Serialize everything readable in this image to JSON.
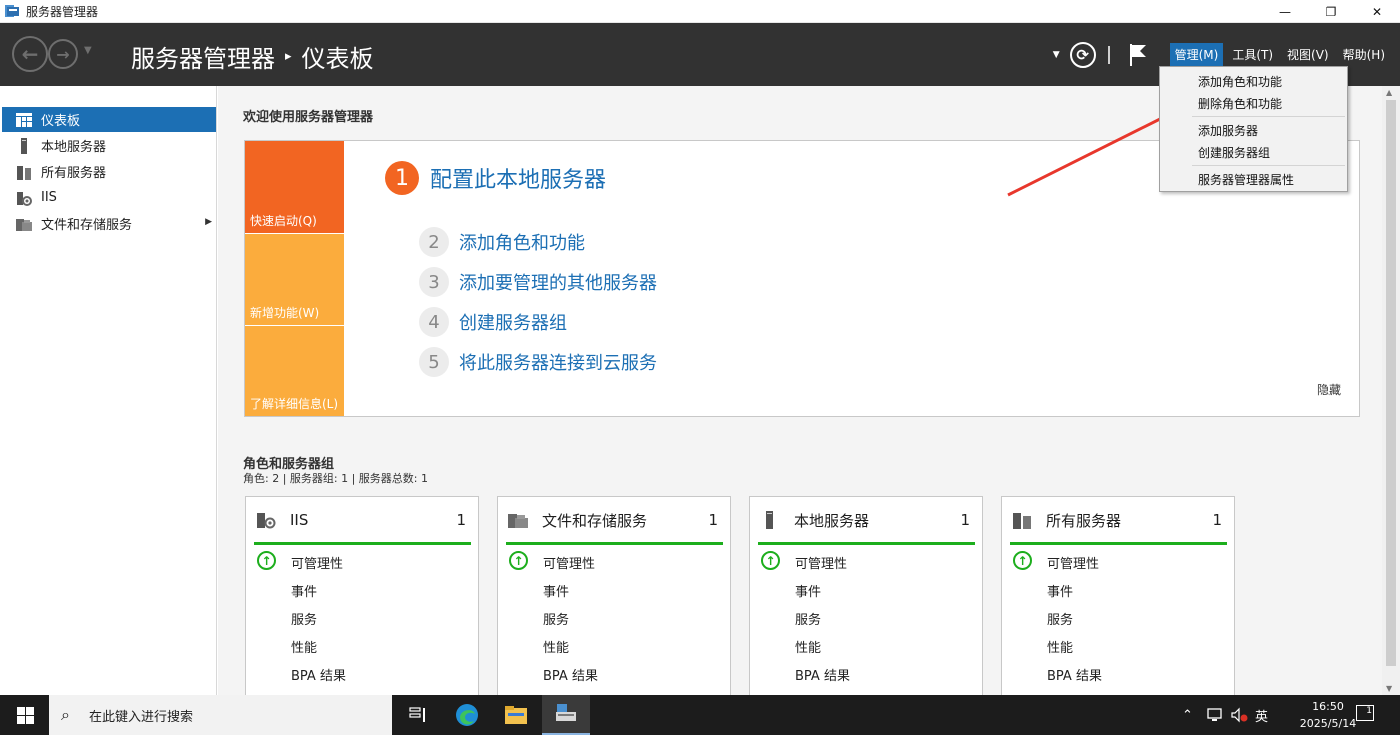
{
  "window": {
    "title": "服务器管理器",
    "min": "—",
    "max": "❐",
    "close": "✕"
  },
  "header": {
    "app_name": "服务器管理器",
    "separator": "▸",
    "page": "仪表板",
    "menus": [
      "管理(M)",
      "工具(T)",
      "视图(V)",
      "帮助(H)"
    ],
    "active_menu": "管理(M)"
  },
  "sidebar": {
    "items": [
      {
        "label": "仪表板",
        "icon": "dashboard-icon",
        "selected": true
      },
      {
        "label": "本地服务器",
        "icon": "server-icon"
      },
      {
        "label": "所有服务器",
        "icon": "servers-icon"
      },
      {
        "label": "IIS",
        "icon": "iis-icon"
      },
      {
        "label": "文件和存储服务",
        "icon": "file-storage-icon",
        "has_submenu": true
      }
    ]
  },
  "welcome": {
    "title": "欢迎使用服务器管理器",
    "tiles": [
      "快速启动(Q)",
      "新增功能(W)",
      "了解详细信息(L)"
    ],
    "steps": [
      {
        "num": "1",
        "label": "配置此本地服务器"
      },
      {
        "num": "2",
        "label": "添加角色和功能"
      },
      {
        "num": "3",
        "label": "添加要管理的其他服务器"
      },
      {
        "num": "4",
        "label": "创建服务器组"
      },
      {
        "num": "5",
        "label": "将此服务器连接到云服务"
      }
    ],
    "hide": "隐藏"
  },
  "roles": {
    "title": "角色和服务器组",
    "summary": "角色: 2 | 服务器组: 1 | 服务器总数: 1",
    "cards": [
      {
        "name": "IIS",
        "count": "1",
        "icon": "iis-icon",
        "rows": [
          "可管理性",
          "事件",
          "服务",
          "性能",
          "BPA 结果"
        ]
      },
      {
        "name": "文件和存储服务",
        "count": "1",
        "icon": "file-storage-icon",
        "rows": [
          "可管理性",
          "事件",
          "服务",
          "性能",
          "BPA 结果"
        ]
      },
      {
        "name": "本地服务器",
        "count": "1",
        "icon": "server-icon",
        "rows": [
          "可管理性",
          "事件",
          "服务",
          "性能",
          "BPA 结果"
        ]
      },
      {
        "name": "所有服务器",
        "count": "1",
        "icon": "servers-icon",
        "rows": [
          "可管理性",
          "事件",
          "服务",
          "性能",
          "BPA 结果"
        ]
      }
    ]
  },
  "manage_menu": {
    "items": [
      "添加角色和功能",
      "删除角色和功能",
      "添加服务器",
      "创建服务器组",
      "服务器管理器属性"
    ]
  },
  "taskbar": {
    "search_placeholder": "在此键入进行搜索",
    "ime": "英",
    "time": "16:50",
    "date": "2025/5/14",
    "notifications": "1"
  },
  "colors": {
    "accent": "#1c6fb4",
    "quick_start": "#f26522",
    "tile": "#fbac3d",
    "ok_green": "#1dae1d",
    "annotation_arrow": "#e8372c"
  }
}
